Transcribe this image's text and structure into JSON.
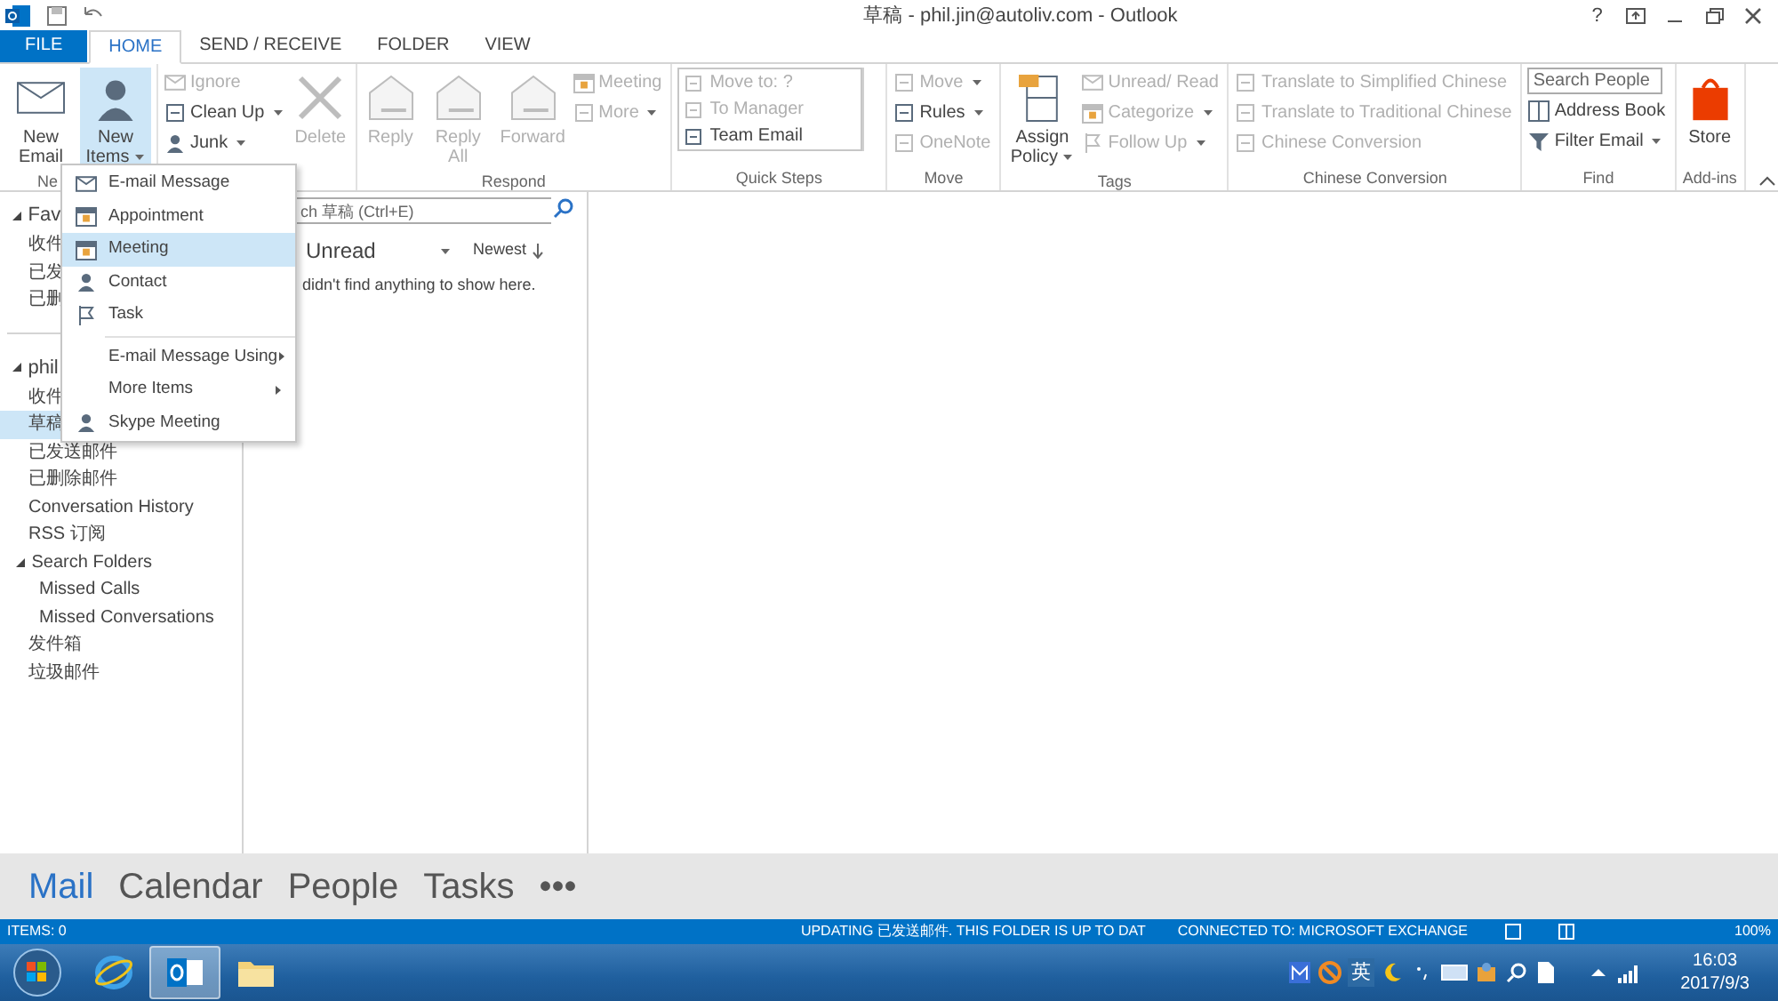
{
  "window": {
    "title": "草稿 - phil.jin@autoliv.com - Outlook",
    "help": "?"
  },
  "tabs": [
    {
      "label": "FILE",
      "kind": "file",
      "selected": false
    },
    {
      "label": "HOME",
      "kind": "tab",
      "selected": true
    },
    {
      "label": "SEND / RECEIVE",
      "kind": "tab",
      "selected": false
    },
    {
      "label": "FOLDER",
      "kind": "tab",
      "selected": false
    },
    {
      "label": "VIEW",
      "kind": "tab",
      "selected": false
    }
  ],
  "ribbon": {
    "groups": [
      {
        "label": "Ne",
        "columns": [
          [
            {
              "kind": "large",
              "label": "New Email",
              "disabled": false,
              "dropdown": false,
              "pressed": false
            }
          ],
          [
            {
              "kind": "large",
              "label": "New Items",
              "disabled": false,
              "dropdown": true,
              "pressed": true
            }
          ]
        ]
      },
      {
        "columns": [
          [
            {
              "kind": "small",
              "label": "Ignore",
              "disabled": true,
              "dropdown": false
            },
            {
              "kind": "small",
              "label": "Clean Up",
              "disabled": false,
              "dropdown": true
            },
            {
              "kind": "small",
              "label": "Junk",
              "disabled": false,
              "dropdown": true
            }
          ],
          [
            {
              "kind": "large",
              "label": "Delete",
              "disabled": true,
              "dropdown": false,
              "pressed": false
            }
          ]
        ]
      },
      {
        "label": "Respond",
        "columns": [
          [
            {
              "kind": "large",
              "label": "Reply",
              "disabled": true,
              "dropdown": false,
              "pressed": false
            }
          ],
          [
            {
              "kind": "large",
              "label": "Reply All",
              "disabled": true,
              "dropdown": false,
              "pressed": false
            }
          ],
          [
            {
              "kind": "large",
              "label": "Forward",
              "disabled": true,
              "dropdown": false,
              "pressed": false
            }
          ],
          [
            {
              "kind": "small",
              "label": "Meeting",
              "disabled": true,
              "dropdown": false
            },
            {
              "kind": "small",
              "label": "More",
              "disabled": true,
              "dropdown": true
            }
          ]
        ]
      },
      {
        "label": "Quick Steps",
        "columns": [
          [
            {
              "kind": "gallery",
              "label": "Move to: ?",
              "disabled": true
            },
            {
              "kind": "gallery",
              "label": "To Manager",
              "disabled": true
            },
            {
              "kind": "gallery",
              "label": "Team Email",
              "disabled": false
            }
          ]
        ]
      },
      {
        "label": "Move",
        "columns": [
          [
            {
              "kind": "small",
              "label": "Move",
              "disabled": true,
              "dropdown": true
            },
            {
              "kind": "small",
              "label": "Rules",
              "disabled": false,
              "dropdown": true
            },
            {
              "kind": "small",
              "label": "OneNote",
              "disabled": true,
              "dropdown": false
            }
          ]
        ]
      },
      {
        "label": "Tags",
        "columns": [
          [
            {
              "kind": "large",
              "label": "Assign Policy",
              "disabled": false,
              "dropdown": true,
              "pressed": false
            }
          ],
          [
            {
              "kind": "small",
              "label": "Unread/ Read",
              "disabled": true,
              "dropdown": false
            },
            {
              "kind": "small",
              "label": "Categorize",
              "disabled": true,
              "dropdown": true
            },
            {
              "kind": "small",
              "label": "Follow Up",
              "disabled": true,
              "dropdown": true
            }
          ]
        ]
      },
      {
        "label": "Chinese Conversion",
        "columns": [
          [
            {
              "kind": "small",
              "label": "Translate to Simplified Chinese",
              "disabled": true,
              "dropdown": false
            },
            {
              "kind": "small",
              "label": "Translate to Traditional Chinese",
              "disabled": true,
              "dropdown": false
            },
            {
              "kind": "small",
              "label": "Chinese Conversion",
              "disabled": true,
              "dropdown": false
            }
          ]
        ]
      },
      {
        "label": "Find",
        "columns": [
          [
            {
              "kind": "field",
              "placeholder": "Search People"
            },
            {
              "kind": "small",
              "label": "Address Book",
              "disabled": false,
              "dropdown": false
            },
            {
              "kind": "small",
              "label": "Filter Email",
              "disabled": false,
              "dropdown": true
            }
          ]
        ]
      },
      {
        "label": "Add-ins",
        "columns": [
          [
            {
              "kind": "large",
              "label": "Store",
              "disabled": false,
              "dropdown": false,
              "pressed": false
            }
          ]
        ]
      }
    ]
  },
  "new_items_menu": [
    {
      "kind": "item",
      "label": "E-mail Message",
      "selected": false
    },
    {
      "kind": "item",
      "label": "Appointment",
      "selected": false
    },
    {
      "kind": "item",
      "label": "Meeting",
      "selected": true
    },
    {
      "kind": "item",
      "label": "Contact",
      "selected": false
    },
    {
      "kind": "item",
      "label": "Task",
      "selected": false
    },
    {
      "kind": "submenu",
      "label": "E-mail Message Using",
      "selected": false
    },
    {
      "kind": "submenu",
      "label": "More Items",
      "selected": false
    },
    {
      "kind": "item",
      "label": "Skype Meeting",
      "selected": false
    }
  ],
  "folders": [
    {
      "label": "Fav",
      "expanded": true,
      "selected": false,
      "children": [
        {
          "label": "收件",
          "selected": false
        },
        {
          "label": "已发",
          "selected": false
        },
        {
          "label": "已删",
          "selected": false
        }
      ]
    },
    {
      "label": "phil",
      "expanded": true,
      "selected": false,
      "children": [
        {
          "label": "收件",
          "selected": false
        },
        {
          "label": "草稿",
          "selected": true
        },
        {
          "label": "已发送邮件",
          "selected": false
        },
        {
          "label": "已删除邮件",
          "selected": false
        },
        {
          "label": "Conversation History",
          "selected": false
        },
        {
          "label": "RSS 订阅",
          "selected": false
        },
        {
          "label": "Search Folders",
          "expanded": true,
          "selected": false,
          "children": [
            {
              "label": "Missed Calls",
              "selected": false
            },
            {
              "label": "Missed Conversations",
              "selected": false
            }
          ]
        },
        {
          "label": "发件箱",
          "selected": false
        },
        {
          "label": "垃圾邮件",
          "selected": false
        }
      ]
    }
  ],
  "message_list": {
    "search": {
      "placeholder": "ch 草稿 (Ctrl+E)"
    },
    "filter": "Unread",
    "sort": "Newest",
    "empty_text": "didn't find anything to show here."
  },
  "nav": [
    {
      "label": "Mail",
      "selected": true
    },
    {
      "label": "Calendar",
      "selected": false
    },
    {
      "label": "People",
      "selected": false
    },
    {
      "label": "Tasks",
      "selected": false
    },
    {
      "label": "•••",
      "selected": false
    }
  ],
  "status_bar": {
    "items": "ITEMS: 0",
    "updating": "UPDATING 已发送邮件.  THIS FOLDER IS UP TO DAT",
    "connection": "CONNECTED TO: MICROSOFT EXCHANGE",
    "zoom": "100%"
  },
  "taskbar": {
    "apps": [
      {
        "selected": false
      },
      {
        "selected": true
      },
      {
        "selected": false
      }
    ],
    "ime": "英",
    "time": "16:03",
    "date": "2017/9/3"
  }
}
